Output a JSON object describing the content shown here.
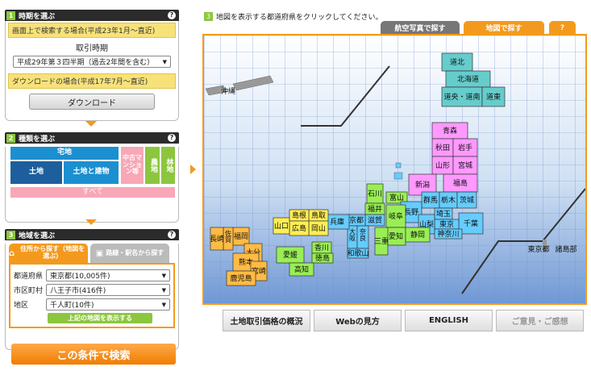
{
  "left": {
    "time": {
      "num": "1",
      "title": "時期を選ぶ",
      "help": "?",
      "screen_header": "画面上で検索する場合(平成23年1月〜直近)",
      "period_label": "取引時期",
      "period_value": "平成29年第３四半期（過去2年間を含む）",
      "download_header": "ダウンロードの場合(平成17年7月〜直近)",
      "download_button": "ダウンロード"
    },
    "type": {
      "num": "2",
      "title": "種類を選ぶ",
      "help": "?",
      "takuchi": "宅地",
      "tochi": "土地",
      "tochi_tatemono": "土地と建物",
      "chuko_mansion": "中古マンション等",
      "nouchi": "農地",
      "rinchi": "林地",
      "all": "すべて"
    },
    "area": {
      "num": "3",
      "title": "地域を選ぶ",
      "help": "?",
      "tab_address": "住所から探す（地図を選ぶ）",
      "tab_station": "路線・駅名から探す",
      "pref_label": "都道府県",
      "pref_value": "東京都(10,005件)",
      "city_label": "市区町村",
      "city_value": "八王子市(416件)",
      "district_label": "地区",
      "district_value": "千人町(10件)",
      "show_map_button": "上記の地図を表示する"
    },
    "search_button": "この条件で検索"
  },
  "map": {
    "num": "3",
    "instruction": "地図を表示する都道府県をクリックしてください。",
    "tab_aerial": "航空写真で探す",
    "tab_map": "地図で探す",
    "tab_help": "?",
    "prefectures": [
      {
        "name": "道北",
        "color": "#66cccc"
      },
      {
        "name": "北海道",
        "color": "#66cccc"
      },
      {
        "name": "道央・道南",
        "color": "#66cccc"
      },
      {
        "name": "道東",
        "color": "#66cccc"
      },
      {
        "name": "青森",
        "color": "#ff99ff"
      },
      {
        "name": "秋田",
        "color": "#ff99ff"
      },
      {
        "name": "岩手",
        "color": "#ff99ff"
      },
      {
        "name": "山形",
        "color": "#ff99ff"
      },
      {
        "name": "宮城",
        "color": "#ff99ff"
      },
      {
        "name": "福島",
        "color": "#ff99ff"
      },
      {
        "name": "新潟",
        "color": "#ff99ff"
      },
      {
        "name": "石川",
        "color": "#99ee55"
      },
      {
        "name": "富山",
        "color": "#99ee55"
      },
      {
        "name": "福井",
        "color": "#99ee55"
      },
      {
        "name": "群馬",
        "color": "#66ccff"
      },
      {
        "name": "栃木",
        "color": "#66ccff"
      },
      {
        "name": "茨城",
        "color": "#66ccff"
      },
      {
        "name": "長野",
        "color": "#66ccff"
      },
      {
        "name": "埼玉",
        "color": "#66ccff"
      },
      {
        "name": "千葉",
        "color": "#66ccff"
      },
      {
        "name": "東京",
        "color": "#66ccff"
      },
      {
        "name": "山梨",
        "color": "#66ccff"
      },
      {
        "name": "神奈川",
        "color": "#66ccff"
      },
      {
        "name": "岐阜",
        "color": "#99ee55"
      },
      {
        "name": "愛知",
        "color": "#99ee55"
      },
      {
        "name": "静岡",
        "color": "#99ee55"
      },
      {
        "name": "三重",
        "color": "#99ee55"
      },
      {
        "name": "滋賀",
        "color": "#66ccff"
      },
      {
        "name": "京都",
        "color": "#66ccff"
      },
      {
        "name": "大阪",
        "color": "#66ccff"
      },
      {
        "name": "兵庫",
        "color": "#66ccff"
      },
      {
        "name": "奈良",
        "color": "#66ccff"
      },
      {
        "name": "和歌山",
        "color": "#66ccff"
      },
      {
        "name": "鳥取",
        "color": "#ffee55"
      },
      {
        "name": "島根",
        "color": "#ffee55"
      },
      {
        "name": "岡山",
        "color": "#ffee55"
      },
      {
        "name": "広島",
        "color": "#ffee55"
      },
      {
        "name": "山口",
        "color": "#ffee55"
      },
      {
        "name": "香川",
        "color": "#99ee55"
      },
      {
        "name": "徳島",
        "color": "#99ee55"
      },
      {
        "name": "愛媛",
        "color": "#99ee55"
      },
      {
        "name": "高知",
        "color": "#99ee55"
      },
      {
        "name": "福岡",
        "color": "#ffbb44"
      },
      {
        "name": "佐賀",
        "color": "#ffbb44"
      },
      {
        "name": "長崎",
        "color": "#ffbb44"
      },
      {
        "name": "大分",
        "color": "#ffbb44"
      },
      {
        "name": "熊本",
        "color": "#ffbb44"
      },
      {
        "name": "宮崎",
        "color": "#ffbb44"
      },
      {
        "name": "鹿児島",
        "color": "#ffbb44"
      },
      {
        "name": "沖縄",
        "color": "#999999"
      },
      {
        "name": "東京都",
        "color": "#999999"
      },
      {
        "name": "諸島部",
        "color": "#999999"
      }
    ]
  },
  "bottom": {
    "overview": "土地取引価格の概況",
    "how_to": "Webの見方",
    "english": "ENGLISH",
    "feedback": "ご意見・ご感想"
  },
  "colors": {
    "accent": "#f39a1e",
    "green": "#8cc63f",
    "dark": "#2b2b2b",
    "navy": "#1d5f9c",
    "blue": "#1b8fd0",
    "pink": "#f7a7b6"
  }
}
